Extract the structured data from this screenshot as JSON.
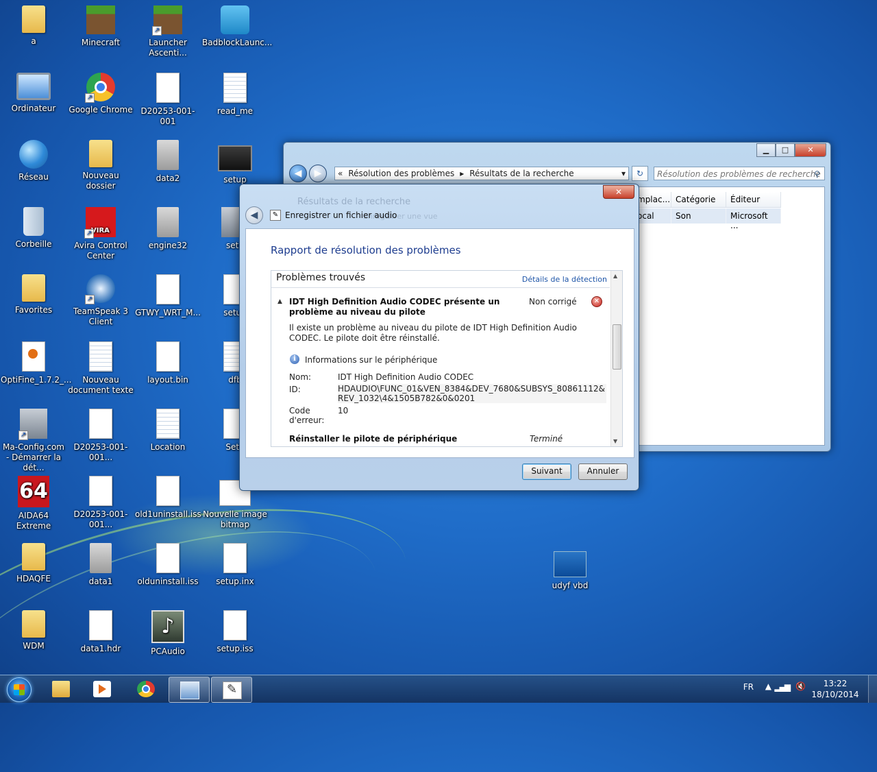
{
  "desktop": {
    "icons": [
      {
        "label": "a"
      },
      {
        "label": "Minecraft"
      },
      {
        "label": "Launcher Ascenti..."
      },
      {
        "label": "BadblockLaunc..."
      },
      {
        "label": "Ordinateur"
      },
      {
        "label": "Google Chrome"
      },
      {
        "label": "D20253-001-001"
      },
      {
        "label": "read_me"
      },
      {
        "label": "Réseau"
      },
      {
        "label": "Nouveau dossier"
      },
      {
        "label": "data2"
      },
      {
        "label": "setup"
      },
      {
        "label": "Corbeille"
      },
      {
        "label": "Avira Control Center"
      },
      {
        "label": "engine32"
      },
      {
        "label": "setu"
      },
      {
        "label": "Favorites"
      },
      {
        "label": "TeamSpeak 3 Client"
      },
      {
        "label": "GTWY_WRT_M..."
      },
      {
        "label": "setup"
      },
      {
        "label": "OptiFine_1.7.2_..."
      },
      {
        "label": "Nouveau document texte"
      },
      {
        "label": "layout.bin"
      },
      {
        "label": "dfb"
      },
      {
        "label": "Ma-Config.com - Démarrer la dét..."
      },
      {
        "label": "D20253-001-001..."
      },
      {
        "label": "Location"
      },
      {
        "label": "Setu"
      },
      {
        "label": "AIDA64 Extreme"
      },
      {
        "label": "D20253-001-001..."
      },
      {
        "label": "old1uninstall.iss"
      },
      {
        "label": "Nouvelle image bitmap"
      },
      {
        "label": "HDAQFE"
      },
      {
        "label": "data1"
      },
      {
        "label": "olduninstall.iss"
      },
      {
        "label": "setup.inx"
      },
      {
        "label": "WDM"
      },
      {
        "label": "data1.hdr"
      },
      {
        "label": "PCAudio"
      },
      {
        "label": "setup.iss"
      },
      {
        "label": "udyf vbd"
      }
    ],
    "aida_glyph": "64",
    "pcaudio_glyph": "♪"
  },
  "explorer": {
    "breadcrumb_prefix": "«",
    "breadcrumb_1": "Résolution des problèmes",
    "breadcrumb_sep": "▸",
    "breadcrumb_2": "Résultats de la recherche",
    "dropdown": "▾",
    "refresh": "↻",
    "search_placeholder": "Résolution des problèmes de recherche",
    "search_icon": "⚲",
    "columns": [
      "mplac...",
      "Catégorie",
      "Éditeur"
    ],
    "row": [
      "ocal",
      "Son",
      "Microsoft ..."
    ],
    "minimize": "▁",
    "maximize": "□",
    "close": "✕",
    "back": "◀",
    "forward": "▶"
  },
  "dialog": {
    "ghost_title": "Résultats de la recherche",
    "ghost_sub": "Enregistrer une vue",
    "close": "✕",
    "back": "◀",
    "app_icon": "✎",
    "title": "Enregistrer un fichier audio",
    "report_title": "Rapport de résolution des problèmes",
    "section_title": "Problèmes trouvés",
    "details_link": "Détails de la détection",
    "collapse": "▲",
    "problem_title": "IDT High Definition Audio CODEC présente un problème au niveau du pilote",
    "problem_status": "Non corrigé",
    "error_icon": "✕",
    "description": "Il existe un problème au niveau du pilote de IDT High Definition Audio CODEC. Le pilote doit être réinstallé.",
    "info_icon": "i",
    "info_header": "Informations sur le périphérique",
    "name_label": "Nom:",
    "name_value": "IDT High Definition Audio CODEC",
    "id_label": "ID:",
    "id_value": "HDAUDIO\\FUNC_01&VEN_8384&DEV_7680&SUBSYS_80861112&REV_1032\\4&1505B782&0&0201",
    "code_label": "Code d'erreur:",
    "code_value": "10",
    "reinstall_label": "Réinstaller le pilote de périphérique",
    "reinstall_status": "Terminé",
    "scroll_up": "▲",
    "scroll_down": "▼",
    "next_button": "Suivant",
    "cancel_button": "Annuler"
  },
  "taskbar": {
    "language": "FR",
    "tray_chevron": "▲",
    "network": "▂▄▆",
    "volume": "🔇",
    "time": "13:22",
    "date": "18/10/2014"
  }
}
